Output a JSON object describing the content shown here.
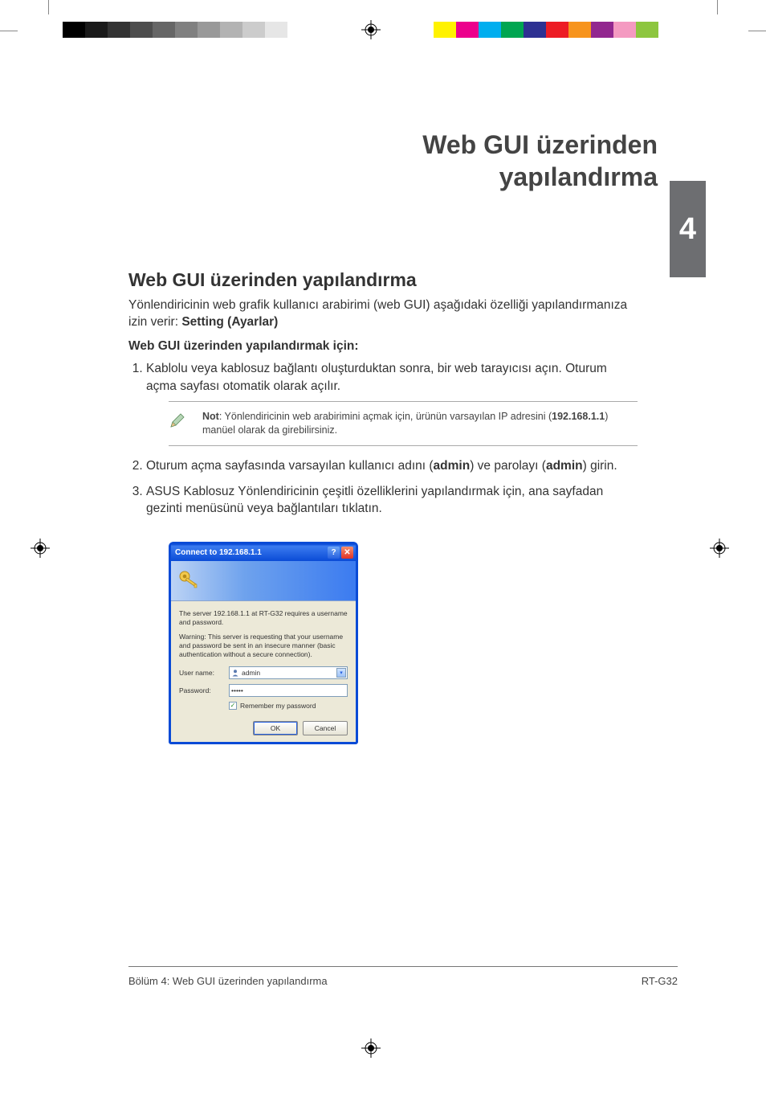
{
  "print_marks": {
    "grayscale": [
      "#000000",
      "#1a1a1a",
      "#333333",
      "#4d4d4d",
      "#666666",
      "#808080",
      "#999999",
      "#b3b3b3",
      "#cccccc",
      "#e6e6e6"
    ],
    "colors": [
      "#fff200",
      "#ec008c",
      "#00aeef",
      "#00a651",
      "#2e3192",
      "#ed1c24",
      "#f7941d",
      "#92278f",
      "#f49ac1",
      "#8dc63f"
    ]
  },
  "chapter": {
    "number": "4",
    "title_line1": "Web GUI üzerinden",
    "title_line2": "yapılandırma"
  },
  "section": {
    "heading": "Web GUI üzerinden yapılandırma",
    "intro_prefix": "Yönlendiricinin web grafik kullanıcı arabirimi (web GUI) aşağıdaki özelliği yapılandırmanıza izin verir: ",
    "intro_bold": "Setting (Ayarlar)",
    "instructions_label": "Web GUI üzerinden yapılandırmak için:"
  },
  "steps": {
    "s1": "Kablolu veya kablosuz bağlantı oluşturduktan sonra, bir web tarayıcısı açın. Oturum açma sayfası otomatik olarak açılır.",
    "s2_p1": "Oturum açma sayfasında varsayılan kullanıcı adını (",
    "s2_b1": "admin",
    "s2_p2": ") ve parolayı (",
    "s2_b2": "admin",
    "s2_p3": ") girin.",
    "s3": "ASUS Kablosuz Yönlendiricinin çeşitli özelliklerini yapılandırmak için, ana sayfadan gezinti menüsünü veya bağlantıları tıklatın."
  },
  "note": {
    "label": "Not",
    "text_p1": ": Yönlendiricinin web arabirimini açmak için, ürünün varsayılan IP adresini (",
    "ip": "192.168.1.1",
    "text_p2": ") manüel olarak da girebilirsiniz."
  },
  "dialog": {
    "title": "Connect to 192.168.1.1",
    "msg1": "The server 192.168.1.1 at RT-G32 requires a username and password.",
    "msg2": "Warning: This server is requesting that your username and password be sent in an insecure manner (basic authentication without a secure connection).",
    "username_label": "User name:",
    "username_value": "admin",
    "password_label": "Password:",
    "password_value": "•••••",
    "remember_label": "Remember my password",
    "ok": "OK",
    "cancel": "Cancel"
  },
  "footer": {
    "left": "Bölüm 4: Web GUI üzerinden yapılandırma",
    "right": "RT-G32"
  }
}
